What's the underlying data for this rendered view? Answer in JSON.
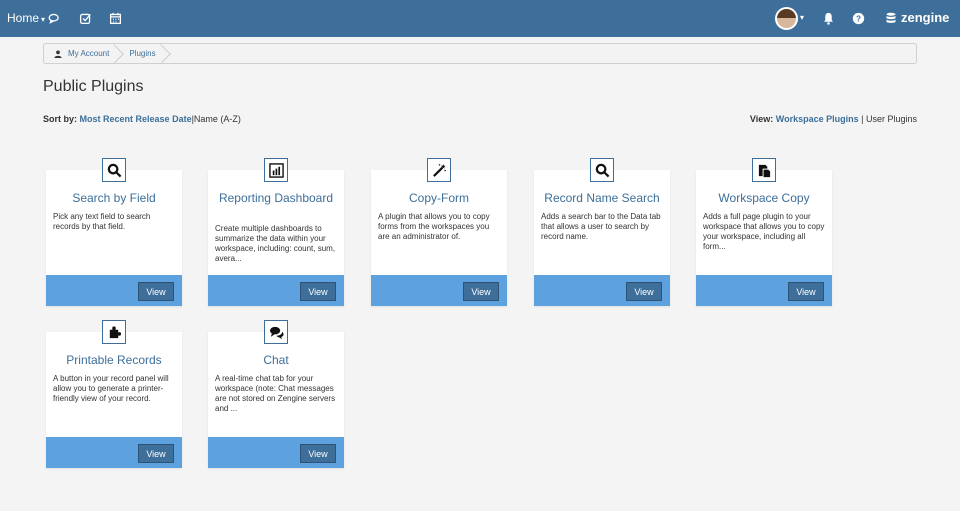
{
  "nav": {
    "home_label": "Home",
    "caret": "▾",
    "brand": "zengine",
    "icons": [
      "chat-icon",
      "checkbox-icon",
      "calendar-icon",
      "bell-icon",
      "help-icon",
      "db-icon"
    ]
  },
  "breadcrumb": {
    "items": [
      "My Account",
      "Plugins"
    ]
  },
  "page": {
    "title": "Public Plugins"
  },
  "sort": {
    "label": "Sort by:",
    "option_1": "Most Recent Release Date",
    "separator": "|",
    "option_2": "Name (A-Z)"
  },
  "view": {
    "label": "View:",
    "option_1": "Workspace Plugins",
    "separator": " | ",
    "option_2": "User Plugins"
  },
  "cards": [
    {
      "title": "Search by Field",
      "desc": "Pick any text field to search records by that field.",
      "button": "View",
      "icon": "search-icon"
    },
    {
      "title": "Reporting Dashboard",
      "desc": "Create multiple dashboards to summarize the data within your workspace, including: count, sum, avera...",
      "button": "View",
      "icon": "chart-icon"
    },
    {
      "title": "Copy-Form",
      "desc": "A plugin that allows you to copy forms from the workspaces you are an administrator of.",
      "button": "View",
      "icon": "magic-wand-icon"
    },
    {
      "title": "Record Name Search",
      "desc": "Adds a search bar to the Data tab that allows a user to search by record name.",
      "button": "View",
      "icon": "search-icon"
    },
    {
      "title": "Workspace Copy",
      "desc": "Adds a full page plugin to your workspace that allows you to copy your workspace, including all form...",
      "button": "View",
      "icon": "copy-icon"
    },
    {
      "title": "Printable Records",
      "desc": "A button in your record panel will allow you to generate a printer-friendly view of your record.",
      "button": "View",
      "icon": "puzzle-icon"
    },
    {
      "title": "Chat",
      "desc": "A real-time chat tab for your workspace (note: Chat messages are not stored on Zengine servers and ...",
      "button": "View",
      "icon": "chat-bubbles-icon"
    }
  ],
  "colors": {
    "nav_bg": "#3d6f9a",
    "accent": "#3d6f9a",
    "card_footer": "#5da2df"
  }
}
